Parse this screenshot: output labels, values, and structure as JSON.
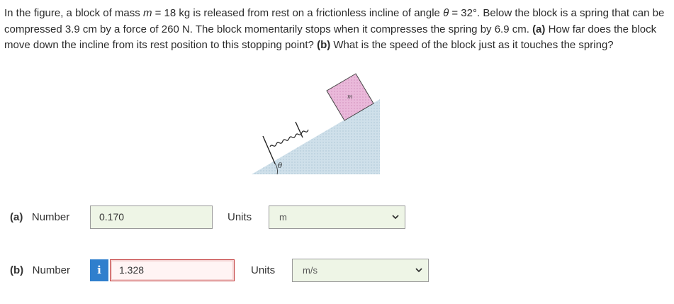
{
  "problem": {
    "p1": "In the figure, a block of mass ",
    "m": "m",
    "p2": " = 18 kg is released from rest on a frictionless incline of angle ",
    "theta": "θ",
    "p3": " = 32°. Below the block is a spring that can be compressed 3.9 cm by a force of 260 N. The block momentarily stops when it compresses the spring by 6.9 cm. ",
    "a_label": "(a)",
    "a_text": " How far does the block move down the incline from its rest position to this stopping point? ",
    "b_label": "(b)",
    "b_text": " What is the speed of the block just as it touches the spring?"
  },
  "figure": {
    "block_label": "m",
    "angle_label": "θ"
  },
  "part_a": {
    "label": "(a)",
    "number_label": "Number",
    "value": "0.170",
    "units_label": "Units",
    "unit_selected": "m"
  },
  "part_b": {
    "label": "(b)",
    "number_label": "Number",
    "info_icon": "i",
    "value": "1.328",
    "units_label": "Units",
    "unit_selected": "m/s"
  },
  "colors": {
    "field_bg": "#eef5e6",
    "info_blue": "#2f7fcd",
    "error_red": "#c23a3a",
    "block_pink": "#e8b4d8",
    "incline_blue": "#c9dde8"
  }
}
